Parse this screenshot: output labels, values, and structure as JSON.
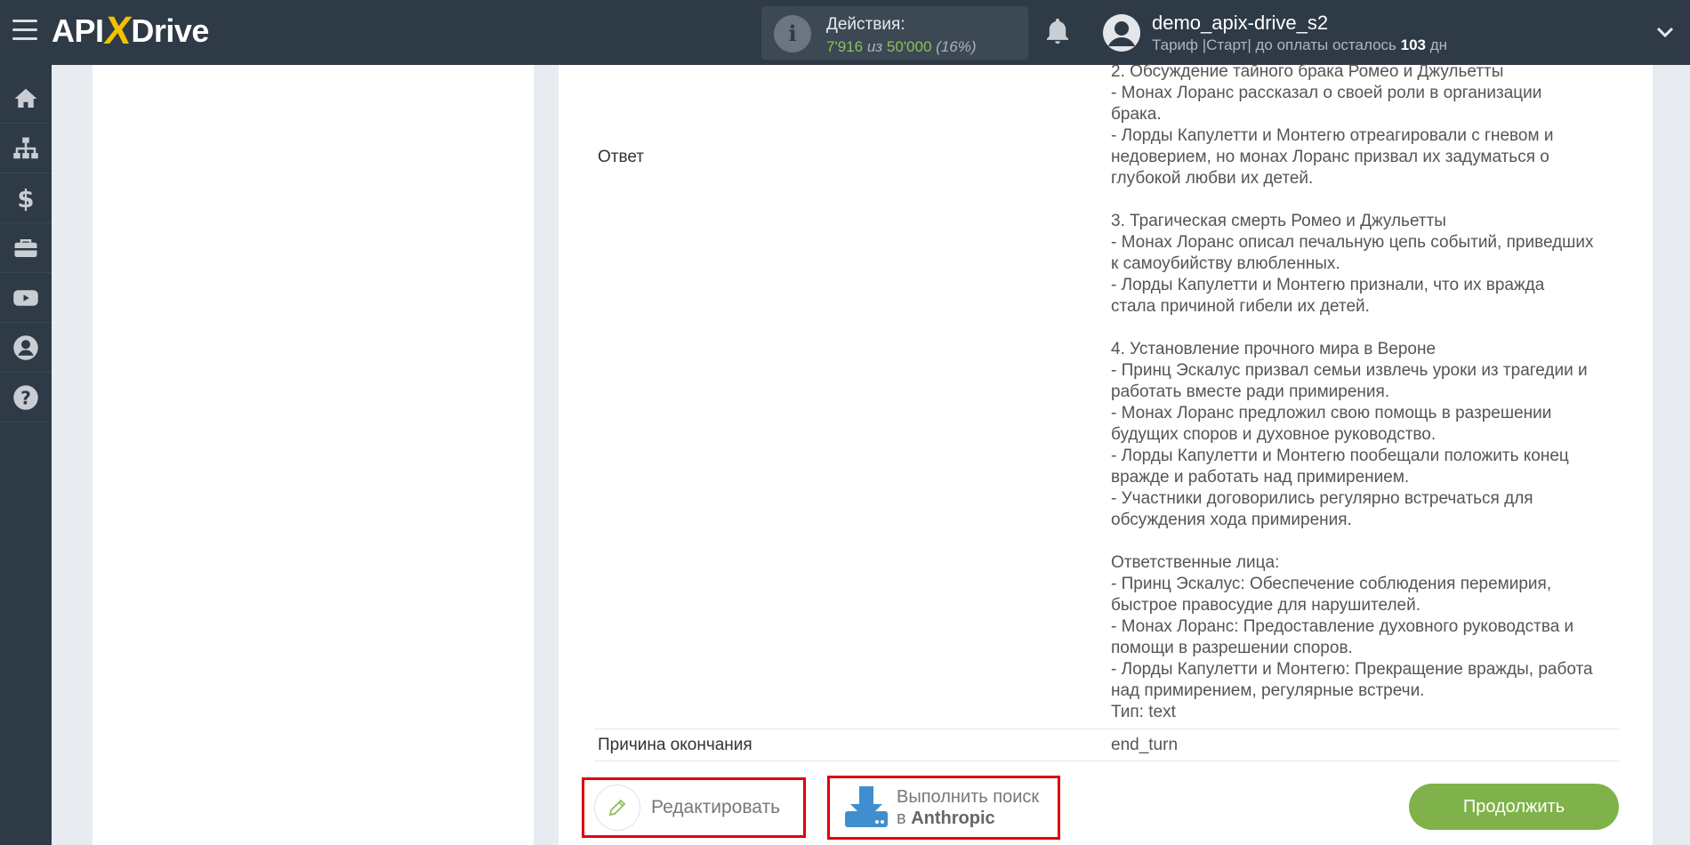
{
  "header": {
    "logo": {
      "left": "API",
      "x": "X",
      "right": "Drive"
    },
    "actions": {
      "label": "Действия:",
      "used": "7'916",
      "of": "из",
      "total": "50'000",
      "percent": "(16%)"
    },
    "user": {
      "name": "demo_apix-drive_s2",
      "plan_prefix": "Тариф |Старт| до оплаты осталось",
      "days": "103",
      "days_unit": "дн"
    }
  },
  "sidebar": {
    "items": [
      {
        "icon": "home-icon"
      },
      {
        "icon": "sitemap-icon"
      },
      {
        "icon": "dollar-icon"
      },
      {
        "icon": "briefcase-icon"
      },
      {
        "icon": "youtube-icon"
      },
      {
        "icon": "user-icon"
      },
      {
        "icon": "help-icon"
      }
    ]
  },
  "result": {
    "answer_label": "Ответ",
    "answer_lines": [
      "2. Обсуждение тайного брака Ромео и Джульетты",
      "- Монах Лоранс рассказал о своей роли в организации",
      "брака.",
      "- Лорды Капулетти и Монтегю отреагировали с гневом и",
      "недоверием, но монах Лоранс призвал их задуматься о",
      "глубокой любви их детей.",
      "",
      "3. Трагическая смерть Ромео и Джульетты",
      "- Монах Лоранс описал печальную цепь событий, приведших",
      "к самоубийству влюбленных.",
      "- Лорды Капулетти и Монтегю признали, что их вражда",
      "стала причиной гибели их детей.",
      "",
      "4. Установление прочного мира в Вероне",
      "- Принц Эскалус призвал семьи извлечь уроки из трагедии и",
      "работать вместе ради примирения.",
      "- Монах Лоранс предложил свою помощь в разрешении",
      "будущих споров и духовное руководство.",
      "- Лорды Капулетти и Монтегю пообещали положить конец",
      "вражде и работать над примирением.",
      "- Участники договорились регулярно встречаться для",
      "обсуждения хода примирения.",
      "",
      "Ответственные лица:",
      "- Принц Эскалус: Обеспечение соблюдения перемирия,",
      "быстрое правосудие для нарушителей.",
      "- Монах Лоранс: Предоставление духовного руководства и",
      "помощи в разрешении споров.",
      "- Лорды Капулетти и Монтегю: Прекращение вражды, работа",
      "над примирением, регулярные встречи.",
      "Тип: text"
    ],
    "finish_label": "Причина окончания",
    "finish_value": "end_turn"
  },
  "buttons": {
    "edit": "Редактировать",
    "search_line1": "Выполнить поиск",
    "search_line2_prefix": "в",
    "search_line2_bold": "Anthropic",
    "continue": "Продолжить"
  },
  "colors": {
    "topbar": "#2e3a46",
    "accent_green": "#7fb24a",
    "highlight_red": "#e0000f",
    "logo_x": "#f2c200"
  }
}
